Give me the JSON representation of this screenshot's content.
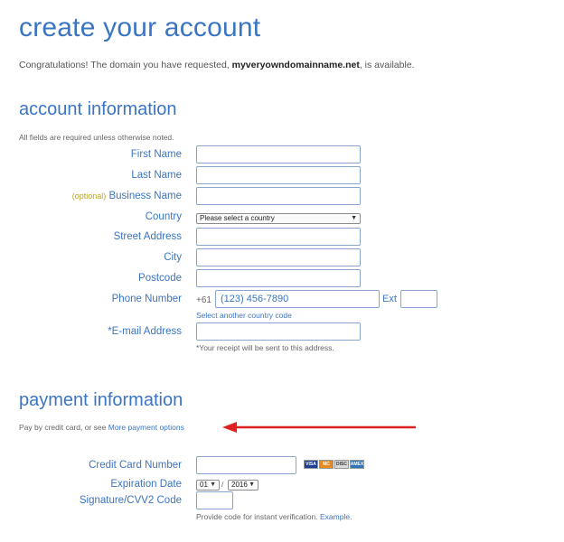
{
  "header": {
    "title": "create your account",
    "intro_prefix": "Congratulations! The domain you have requested, ",
    "domain": "myveryowndomainname.net",
    "intro_suffix": ", is available."
  },
  "account": {
    "heading": "account information",
    "note": "All fields are required unless otherwise noted.",
    "first_name_label": "First Name",
    "last_name_label": "Last Name",
    "optional_tag": "(optional)",
    "business_name_label": "Business Name",
    "country_label": "Country",
    "country_value": "Please select a country",
    "street_label": "Street Address",
    "city_label": "City",
    "postcode_label": "Postcode",
    "phone_label": "Phone Number",
    "phone_prefix": "+61",
    "phone_value": "(123) 456-7890",
    "ext_label": "Ext",
    "select_country_code": "Select another country code",
    "email_label": "*E-mail Address",
    "email_note": "*Your receipt will be sent to this address."
  },
  "payment": {
    "heading": "payment information",
    "pay_prefix": "Pay by credit card, or see ",
    "more_options": "More payment options",
    "card_number_label": "Credit Card Number",
    "card_icons": [
      "VISA",
      "MC",
      "DISC",
      "AMEX"
    ],
    "expiration_label": "Expiration Date",
    "exp_month": "01",
    "exp_separator": "/",
    "exp_year": "2016",
    "cvv_label": "Signature/CVV2 Code",
    "verify_prefix": "Provide code for instant verification. ",
    "example_link": "Example",
    "verify_suffix": "."
  },
  "colors": {
    "accent": "#3a75c4",
    "arrow": "#e02020",
    "optional": "#b6a521"
  },
  "icons": {
    "select_arrow": "chevron-down-icon",
    "annotation": "red-arrow-icon"
  }
}
